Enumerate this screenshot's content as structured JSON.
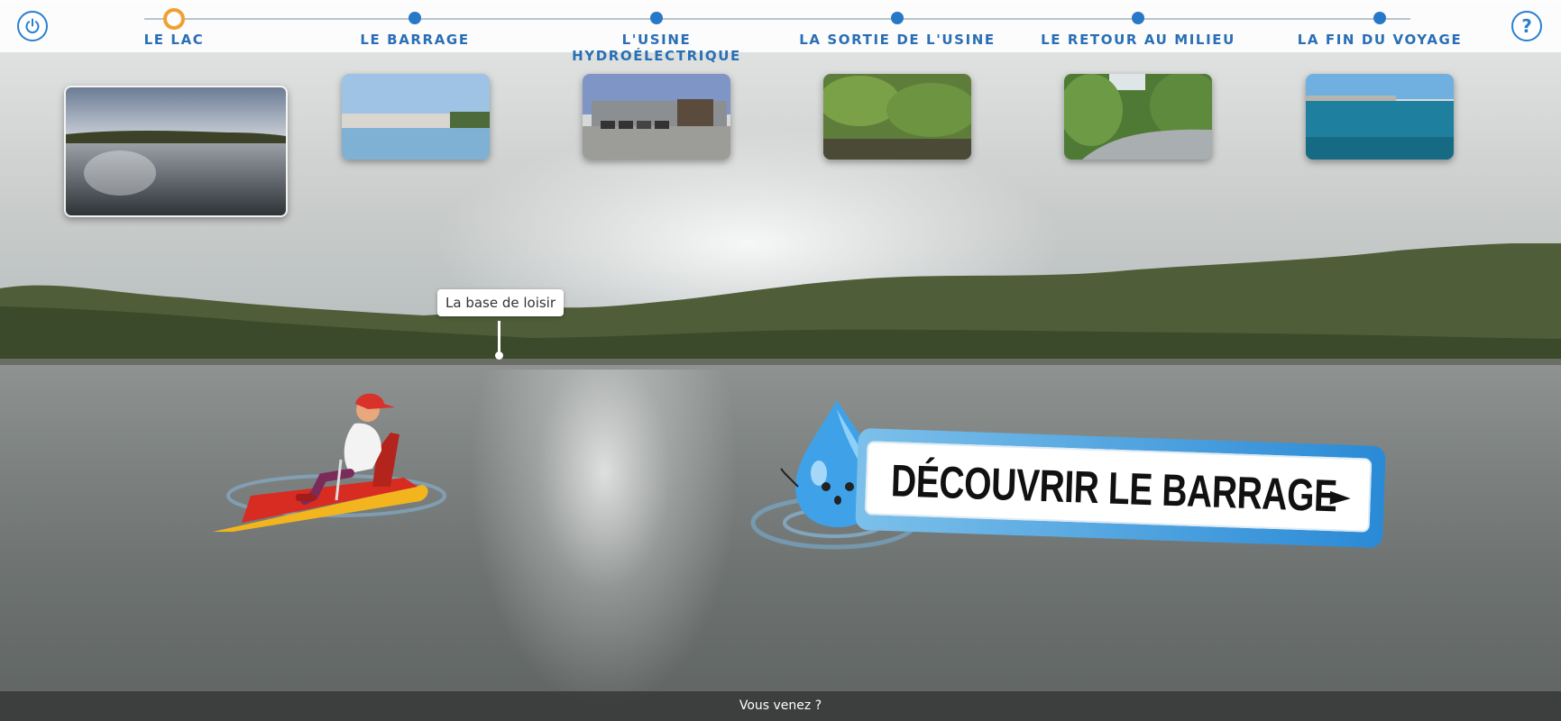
{
  "timeline": {
    "steps": [
      {
        "label": "LE LAC",
        "active": true
      },
      {
        "label": "LE BARRAGE",
        "active": false
      },
      {
        "label": "L'USINE HYDROÉLECTRIQUE",
        "active": false
      },
      {
        "label": "LA SORTIE DE L'USINE",
        "active": false
      },
      {
        "label": "LE RETOUR AU MILIEU",
        "active": false
      },
      {
        "label": "LA FIN DU VOYAGE",
        "active": false
      }
    ]
  },
  "buttons": {
    "power_icon": "power-icon",
    "help_icon": "help-icon",
    "help_glyph": "?"
  },
  "hotspot": {
    "label": "La base de loisir"
  },
  "cta": {
    "label": "DÉCOUVRIR LE BARRAGE",
    "arrow": "►"
  },
  "footer": {
    "caption": "Vous venez ?"
  },
  "colors": {
    "accent_blue": "#2a78c8",
    "active_ring": "#f0a030"
  }
}
